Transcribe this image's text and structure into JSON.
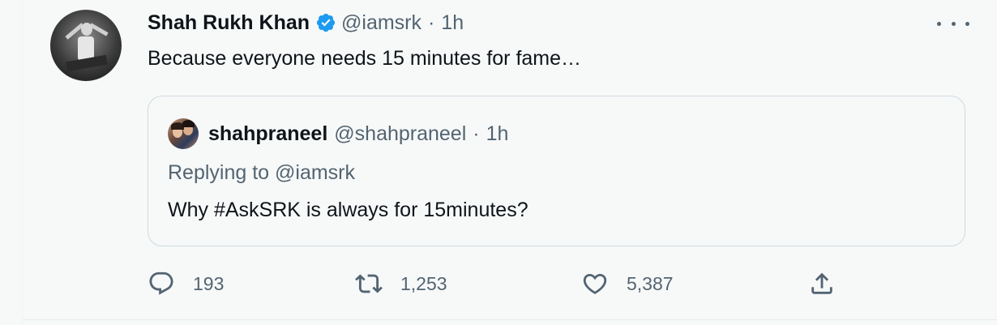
{
  "tweet": {
    "display_name": "Shah Rukh Khan",
    "handle": "@iamsrk",
    "separator": "·",
    "time": "1h",
    "text": "Because everyone needs 15 minutes for fame…",
    "verified": true
  },
  "quoted_tweet": {
    "display_name": "shahpraneel",
    "handle": "@shahpraneel",
    "separator": "·",
    "time": "1h",
    "replying_to": "Replying to @iamsrk",
    "text": "Why #AskSRK is always for 15minutes?"
  },
  "actions": {
    "reply_count": "193",
    "retweet_count": "1,253",
    "like_count": "5,387"
  },
  "icons": {
    "verified": "verified-badge-icon",
    "more": "more-options-icon",
    "reply": "reply-icon",
    "retweet": "retweet-icon",
    "like": "heart-icon",
    "share": "share-icon"
  },
  "colors": {
    "background": "#f7f9f9",
    "text_primary": "#0f1419",
    "text_secondary": "#536471",
    "verified_blue": "#1d9bf0",
    "border": "#cfd9de"
  }
}
